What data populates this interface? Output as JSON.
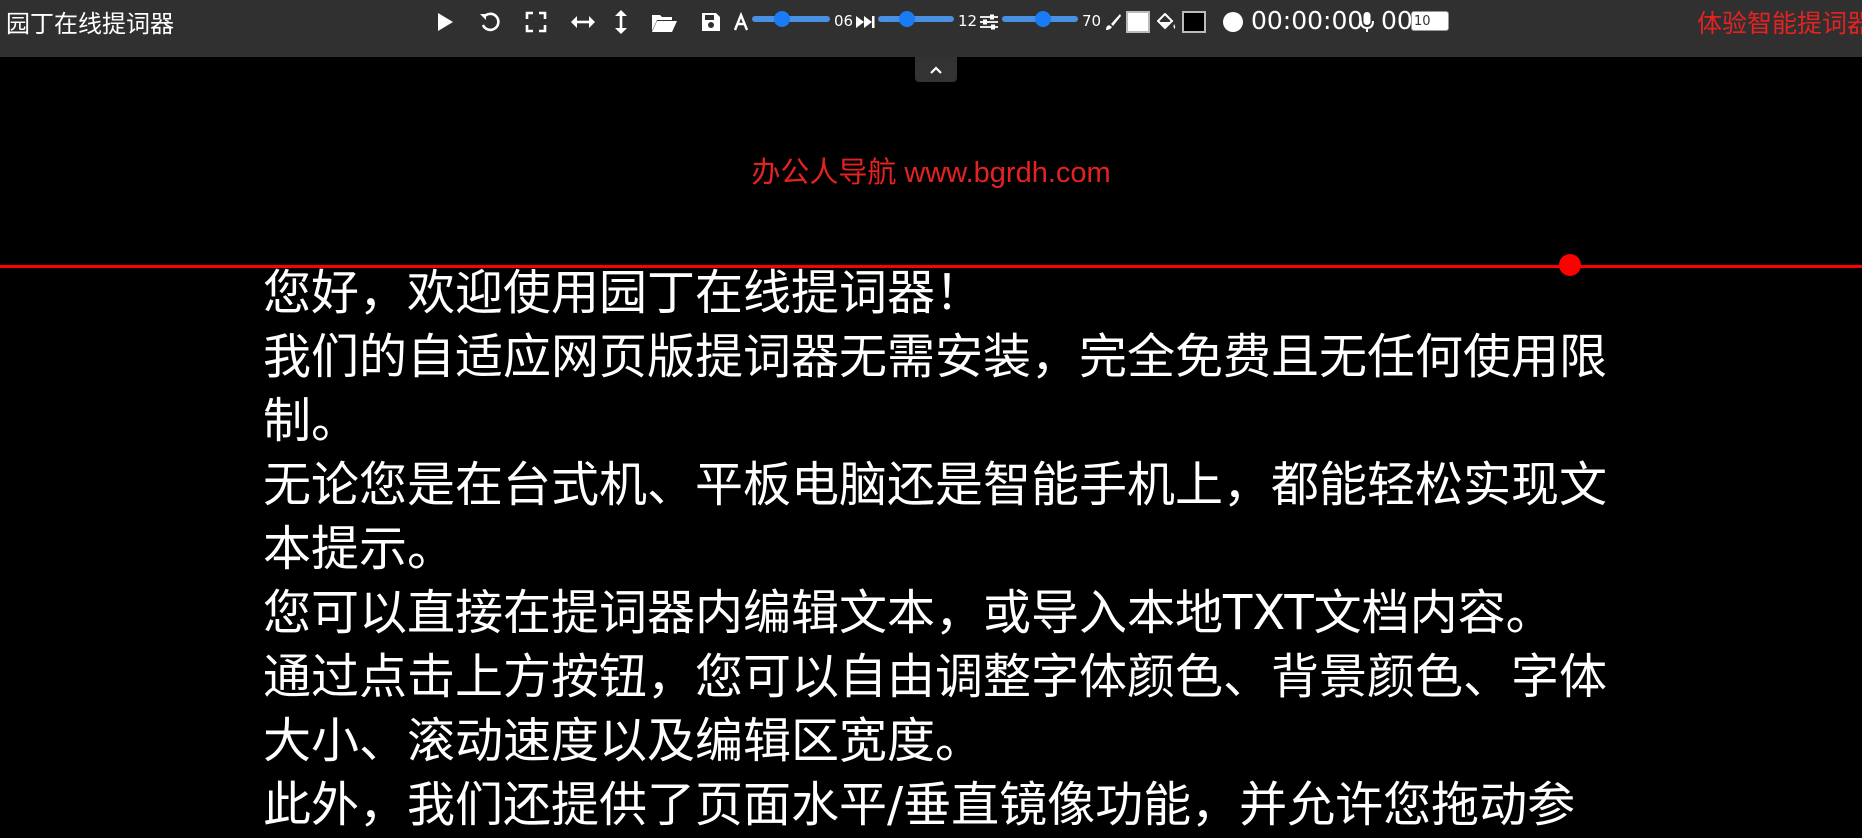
{
  "app": {
    "title": "园丁在线提词器"
  },
  "toolbar": {
    "play_icon": "play-icon",
    "reset_icon": "reset-icon",
    "fullscreen_icon": "fullscreen-icon",
    "mirror_h_icon": "mirror-horizontal-icon",
    "mirror_v_icon": "mirror-vertical-icon",
    "open_icon": "folder-open-icon",
    "save_icon": "save-icon",
    "font_size": {
      "icon": "font-size-icon",
      "value": "06",
      "level": 0.35
    },
    "scroll_speed": {
      "icon": "fast-forward-icon",
      "value": "12",
      "level": 0.35
    },
    "width": {
      "icon": "sliders-icon",
      "value": "70",
      "level": 0.55
    },
    "font_color": {
      "icon": "brush-icon",
      "color": "#ffffff"
    },
    "bg_color": {
      "icon": "fill-bucket-icon",
      "color": "#000000"
    },
    "timer": {
      "icon": "timer-circle-icon",
      "value": "00:00:00"
    },
    "mic": {
      "icon": "microphone-icon",
      "value": "00"
    },
    "countdown_input": "10",
    "promo_link": "体验智能提词器"
  },
  "banner": {
    "text": "办公人导航 www.bgrdh.com"
  },
  "colors": {
    "accent": "#e52222",
    "guide": "#ff0000",
    "slider": "#1a7cf5"
  },
  "script_lines": [
    "您好，欢迎使用园丁在线提词器！",
    "我们的自适应网页版提词器无需安装，完全免费且无任何使用限制。",
    "无论您是在台式机、平板电脑还是智能手机上，都能轻松实现文本提示。",
    "您可以直接在提词器内编辑文本，或导入本地TXT文档内容。",
    "通过点击上方按钮，您可以自由调整字体颜色、背景颜色、字体大小、滚动速度以及编辑区宽度。",
    "此外，我们还提供了页面水平/垂直镜像功能，并允许您拖动参"
  ]
}
